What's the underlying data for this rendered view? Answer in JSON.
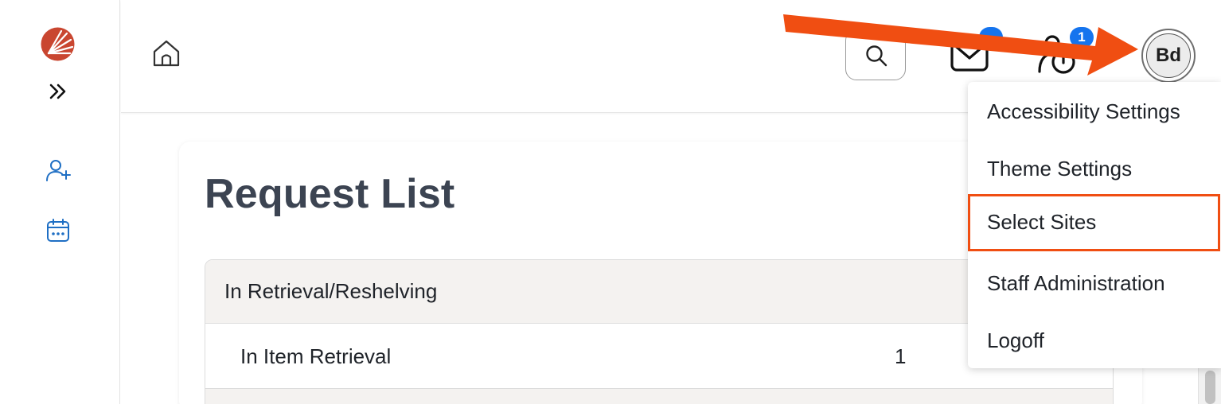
{
  "sidebar": {
    "logo": "logo-icon",
    "expand_icon": "double-chevron-right-icon",
    "items": [
      {
        "icon": "add-person-icon"
      },
      {
        "icon": "calendar-icon"
      }
    ]
  },
  "header": {
    "home_icon": "home-icon",
    "search_icon": "search-icon",
    "mail_icon": "mail-icon",
    "mail_badge": "",
    "sessions_icon": "user-clock-icon",
    "sessions_badge": "1",
    "avatar_initials": "Bd"
  },
  "main": {
    "title": "Request List",
    "table": {
      "header": "In Retrieval/Reshelving",
      "rows": [
        {
          "label": "In Item Retrieval",
          "count": "1"
        }
      ]
    }
  },
  "user_menu": {
    "items": [
      {
        "label": "Accessibility Settings"
      },
      {
        "label": "Theme Settings"
      },
      {
        "label": "Select Sites"
      },
      {
        "label": "Staff Administration"
      },
      {
        "label": "Logoff"
      }
    ],
    "highlighted_index": 2
  },
  "colors": {
    "accent_blue": "#1574ee",
    "annotation_orange": "#f04e12",
    "logo_red": "#c94630",
    "title_gray": "#3c4452"
  }
}
